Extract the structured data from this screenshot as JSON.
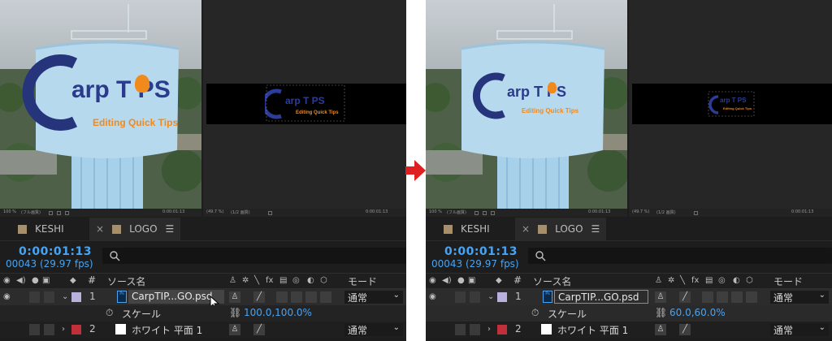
{
  "panels": [
    {
      "tabs": {
        "tab1": "KESHI",
        "tab2": "LOGO"
      },
      "timecode": "0:00:01:13",
      "fps_line": "00043 (29.97 fps)",
      "columns": {
        "source_name": "ソース名",
        "mode": "モード",
        "hash": "#"
      },
      "layer1": {
        "index": "1",
        "name": "CarpTIP...GO.psd",
        "mode": "通常"
      },
      "property": {
        "name": "スケール",
        "value": "100.0,100.0%"
      },
      "layer2": {
        "index": "2",
        "name": "ホワイト 平面 1",
        "mode": "通常"
      },
      "logo": {
        "text_main": "arp T  PS",
        "tagline": "Editing Quick Tips"
      },
      "viewer_bar": {
        "zoom": "100 %",
        "quality": "(フル画質)",
        "zoom2": "(49.7 %)",
        "quality2": "(1/2 画質)",
        "timecode": "0:00:01:13"
      }
    },
    {
      "tabs": {
        "tab1": "KESHI",
        "tab2": "LOGO"
      },
      "timecode": "0:00:01:13",
      "fps_line": "00043 (29.97 fps)",
      "columns": {
        "source_name": "ソース名",
        "mode": "モード",
        "hash": "#"
      },
      "layer1": {
        "index": "1",
        "name": "CarpTIP...GO.psd",
        "mode": "通常"
      },
      "property": {
        "name": "スケール",
        "value": "60.0,60.0%"
      },
      "layer2": {
        "index": "2",
        "name": "ホワイト 平面 1",
        "mode": "通常"
      },
      "logo": {
        "text_main": "arp T  PS",
        "tagline": "Editing Quick Tips"
      },
      "viewer_bar": {
        "zoom": "100 %",
        "quality": "(フル画質)",
        "zoom2": "(49.7 %)",
        "quality2": "(1/2 画質)",
        "timecode": "0:00:01:13"
      }
    }
  ],
  "colors": {
    "accent_blue": "#4aa3f0",
    "logo_navy": "#2a3a8c",
    "logo_orange": "#f08a1c",
    "arrow_red": "#e02020",
    "label_lavender": "#b9b0dd",
    "label_red": "#c0303a"
  }
}
